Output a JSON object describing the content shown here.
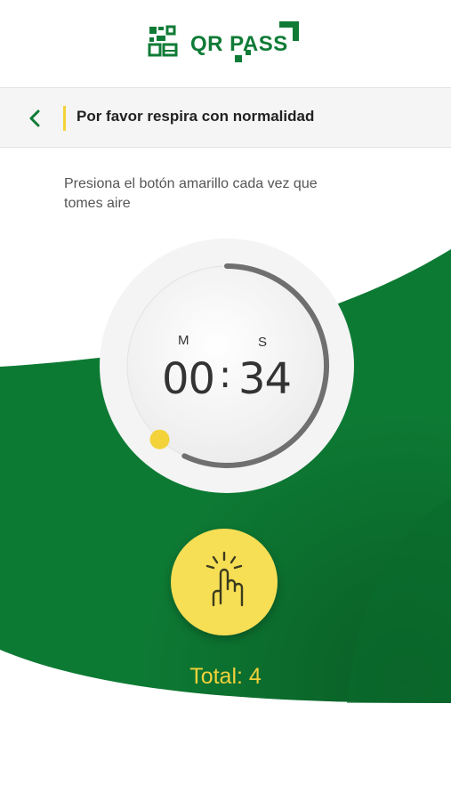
{
  "header": {
    "logo_text": "QR PASS"
  },
  "navbar": {
    "title": "Por favor respira con normalidad",
    "back_icon": "chevron-left-icon"
  },
  "instruction": "Presiona el botón amarillo cada vez que tomes aire",
  "timer": {
    "minutes_label": "M",
    "seconds_label": "S",
    "minutes": "00",
    "separator": ":",
    "seconds": "34",
    "progress_fraction": 0.57
  },
  "tap_button": {
    "icon": "tap-finger-icon"
  },
  "total_label": "Total: 4",
  "colors": {
    "brand_green": "#0f7b36",
    "accent_yellow": "#f3d23a",
    "button_yellow": "#f6de55"
  }
}
